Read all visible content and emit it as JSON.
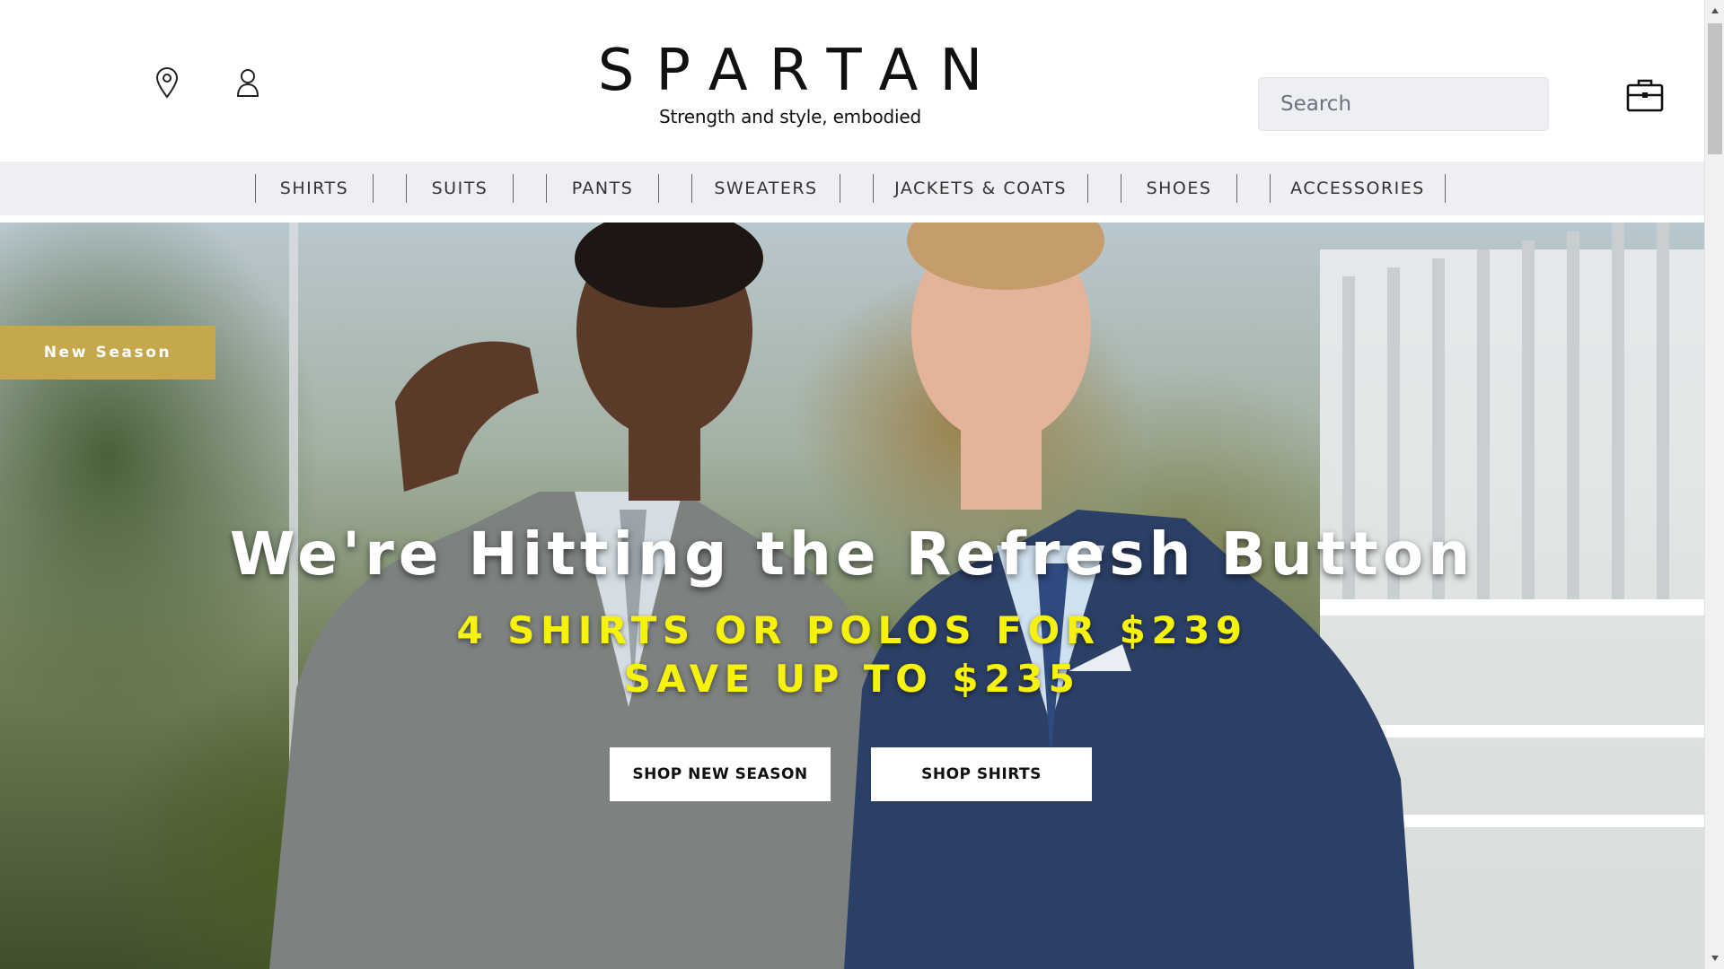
{
  "header": {
    "icons": {
      "location": "map-pin-icon",
      "account": "user-icon",
      "cart": "briefcase-icon",
      "search": "search-icon"
    },
    "logo": {
      "title": "SPARTAN",
      "tagline": "Strength and style, embodied"
    },
    "search": {
      "placeholder": "Search"
    }
  },
  "nav": {
    "items": [
      {
        "label": "SHIRTS"
      },
      {
        "label": "SUITS"
      },
      {
        "label": "PANTS"
      },
      {
        "label": "SWEATERS"
      },
      {
        "label": "JACKETS & COATS"
      },
      {
        "label": "SHOES"
      },
      {
        "label": "ACCESSORIES"
      }
    ]
  },
  "hero": {
    "badge": "New Season",
    "headline": "We're Hitting the Refresh Button",
    "offer_line_1": "4 SHIRTS OR POLOS FOR $239",
    "offer_line_2": "SAVE UP TO $235",
    "buttons": {
      "new_season": "SHOP NEW SEASON",
      "shirts": "SHOP SHIRTS"
    }
  },
  "colors": {
    "badge_bg": "#c4a84b",
    "offer_text": "#f7f20c",
    "nav_bg": "#edeff2"
  }
}
